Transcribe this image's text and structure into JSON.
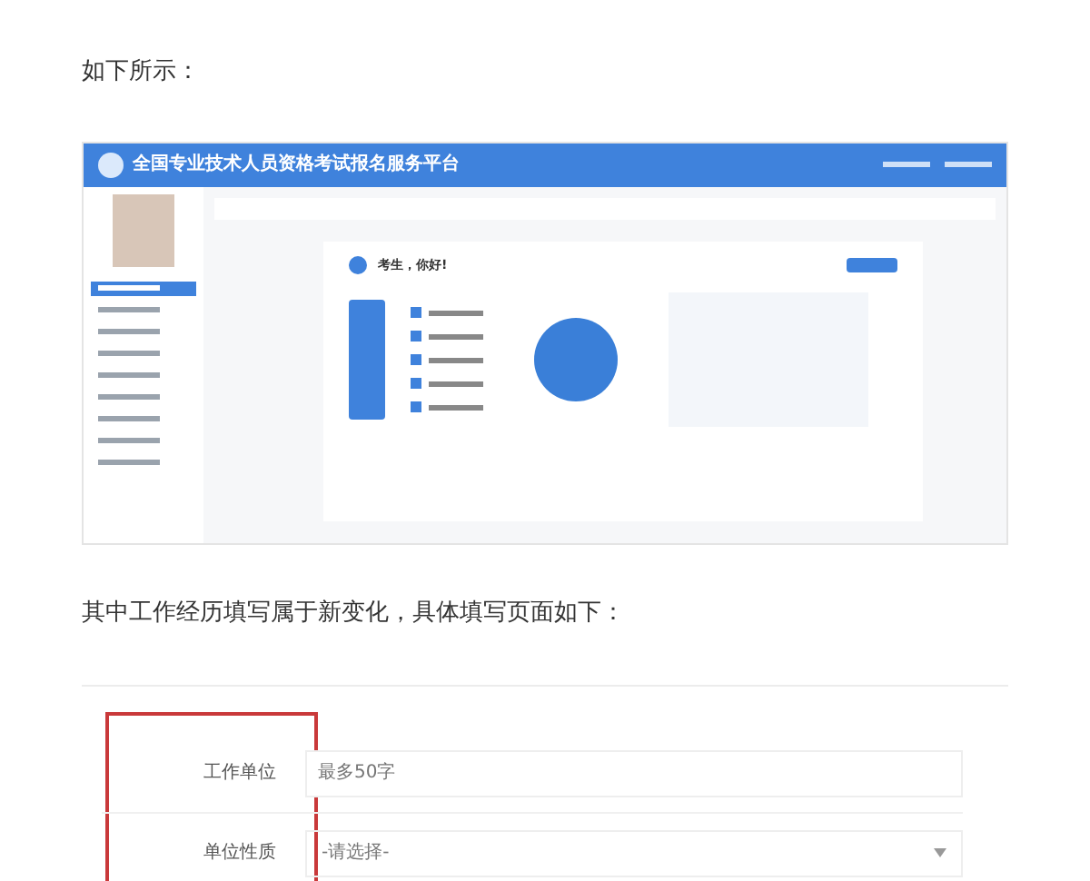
{
  "intro_text": "如下所示：",
  "screenshot": {
    "header_title": "全国专业技术人员资格考试报名服务平台",
    "greeting": "考生，你好!",
    "menu_items": [
      {
        "selected": true
      },
      {
        "selected": false
      },
      {
        "selected": false
      },
      {
        "selected": false
      },
      {
        "selected": false
      },
      {
        "selected": false
      },
      {
        "selected": false
      },
      {
        "selected": false
      },
      {
        "selected": false
      }
    ]
  },
  "note_text": "其中工作经历填写属于新变化，具体填写页面如下：",
  "form": {
    "fields": [
      {
        "kind": "text",
        "label": "工作单位",
        "placeholder": "最多50字"
      },
      {
        "kind": "select",
        "label": "单位性质",
        "value": "-请选择-"
      }
    ]
  }
}
